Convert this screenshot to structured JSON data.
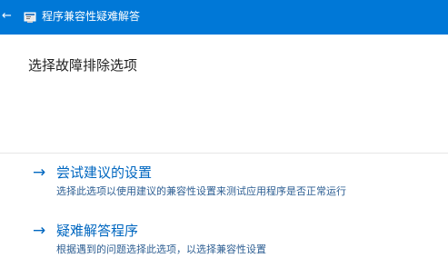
{
  "window": {
    "title": "程序兼容性疑难解答",
    "back_glyph": "←",
    "accent_color": "#0078d7"
  },
  "main": {
    "heading": "选择故障排除选项",
    "options": [
      {
        "arrow": "→",
        "title": "尝试建议的设置",
        "description": "选择此选项以使用建议的兼容性设置来测试应用程序是否正常运行"
      },
      {
        "arrow": "→",
        "title": "疑难解答程序",
        "description": "根据遇到的问题选择此选项，以选择兼容性设置"
      }
    ]
  },
  "icons": {
    "back": "back-arrow-icon",
    "app": "troubleshooter-app-icon",
    "option_arrow": "arrow-right-icon"
  }
}
